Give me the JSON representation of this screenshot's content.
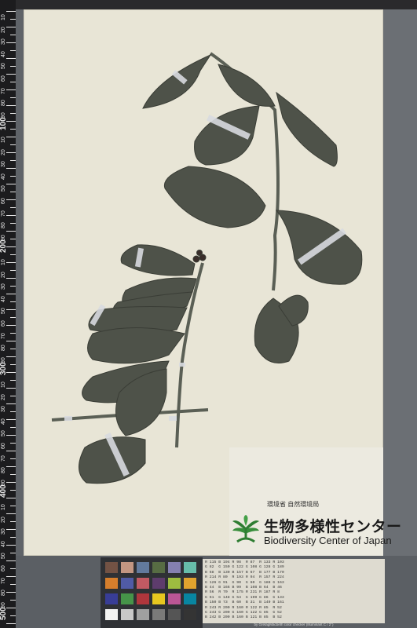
{
  "ruler": {
    "labels": [
      "10",
      "20",
      "30",
      "40",
      "50",
      "60",
      "70",
      "80",
      "90",
      "100",
      "10",
      "20",
      "30",
      "40",
      "50",
      "60",
      "70",
      "80",
      "90",
      "200",
      "10",
      "20",
      "30",
      "40",
      "50",
      "60",
      "70",
      "80",
      "90",
      "300",
      "10",
      "20",
      "30",
      "40",
      "50",
      "60",
      "70",
      "80",
      "90",
      "400",
      "10",
      "20",
      "30",
      "40",
      "50",
      "60",
      "70",
      "80",
      "90",
      "500",
      "10"
    ]
  },
  "label": {
    "agency": "環境省 自然環境局",
    "title_jp": "生物多様性センター",
    "title_en": "Biodiversity Center of Japan"
  },
  "color_table": {
    "rows": [
      "R 115 B 194 R 98  R 87  R 133 R 103",
      "G 82  G 150 G 122 G 108 G 128 G 189",
      "B 68  B 130 B 157 B 67  B 177 B 170",
      "R 214 R 80  R 193 R 94  R 157 R 224",
      "G 126 G 91  G 90  G 60  G 188 G 163",
      "B 44  B 166 B 99  B 108 B 64  B 46",
      "R 56  R 70  R 175 R 231 R 187 R 8",
      "G 61  G 148 G 54  G 199 G 86  G 133",
      "B 150 B 73  B 60  B 31  B 149 B 161",
      "R 243 R 200 R 160 R 122 R 85  R 52",
      "G 243 G 200 G 160 G 122 G 85  G 52",
      "B 242 B 200 B 160 B 121 B 85  B 52"
    ],
    "caption": "by GretagMacbeth color checker (Illuminant C / 2°)"
  },
  "swatch_colors": [
    "#735244",
    "#c29682",
    "#627a9d",
    "#576c43",
    "#8580b1",
    "#67bdaa",
    "#d67e2c",
    "#505ba6",
    "#c15a63",
    "#5e3c6c",
    "#9dbc40",
    "#e0a32e",
    "#383d96",
    "#469449",
    "#af363c",
    "#e7c71f",
    "#bb5695",
    "#0885a1",
    "#f3f3f2",
    "#c8c8c8",
    "#a0a0a0",
    "#7a7a79",
    "#555555",
    "#343434"
  ],
  "colors": {
    "sheet": "#e8e5d6",
    "leaf": "#4e5249",
    "stem": "#5a5f55",
    "label_band": "#d8dbe0"
  }
}
